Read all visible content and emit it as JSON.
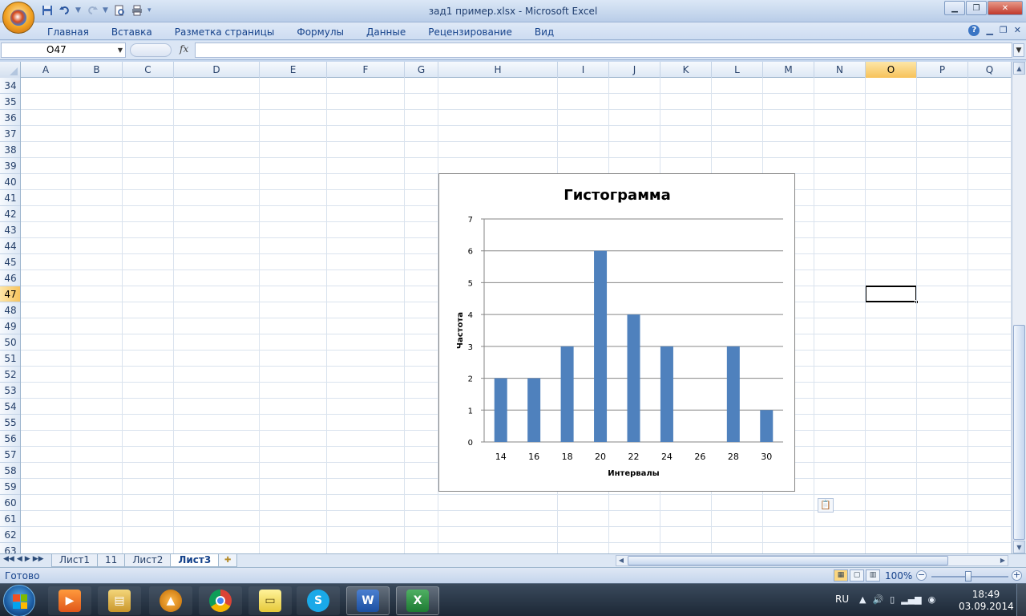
{
  "window": {
    "title": "зад1 пример.xlsx - Microsoft Excel",
    "controls": [
      "minimize",
      "restore",
      "close"
    ]
  },
  "ribbon": {
    "tabs": [
      "Главная",
      "Вставка",
      "Разметка страницы",
      "Формулы",
      "Данные",
      "Рецензирование",
      "Вид"
    ]
  },
  "formula_bar": {
    "name_box": "O47",
    "fx_label": "fx",
    "formula": ""
  },
  "grid": {
    "columns": [
      "A",
      "B",
      "C",
      "D",
      "E",
      "F",
      "G",
      "H",
      "I",
      "J",
      "K",
      "L",
      "M",
      "N",
      "O",
      "P",
      "Q"
    ],
    "rows": [
      "34",
      "35",
      "36",
      "37",
      "38",
      "39",
      "40",
      "41",
      "42",
      "43",
      "44",
      "45",
      "46",
      "47",
      "48",
      "49",
      "50",
      "51",
      "52",
      "53",
      "54",
      "55",
      "56",
      "57",
      "58",
      "59",
      "60",
      "61",
      "62",
      "63"
    ],
    "selected_column": "O",
    "selected_row": "47"
  },
  "chart_data": {
    "type": "bar",
    "title": "Гистограмма",
    "xlabel": "Интервалы",
    "ylabel": "Частота",
    "categories": [
      "14",
      "16",
      "18",
      "20",
      "22",
      "24",
      "26",
      "28",
      "30"
    ],
    "values": [
      2,
      2,
      3,
      6,
      4,
      3,
      0,
      3,
      1
    ],
    "ylim": [
      0,
      7
    ],
    "yticks": [
      0,
      1,
      2,
      3,
      4,
      5,
      6,
      7
    ],
    "grid": true,
    "bar_color": "#4f81bd"
  },
  "sheets": {
    "tabs": [
      "Лист1",
      "11",
      "Лист2",
      "Лист3"
    ],
    "active": "Лист3"
  },
  "status": {
    "text": "Готово",
    "zoom": "100%"
  },
  "taskbar": {
    "language": "RU",
    "time": "18:49",
    "date": "03.09.2014"
  }
}
